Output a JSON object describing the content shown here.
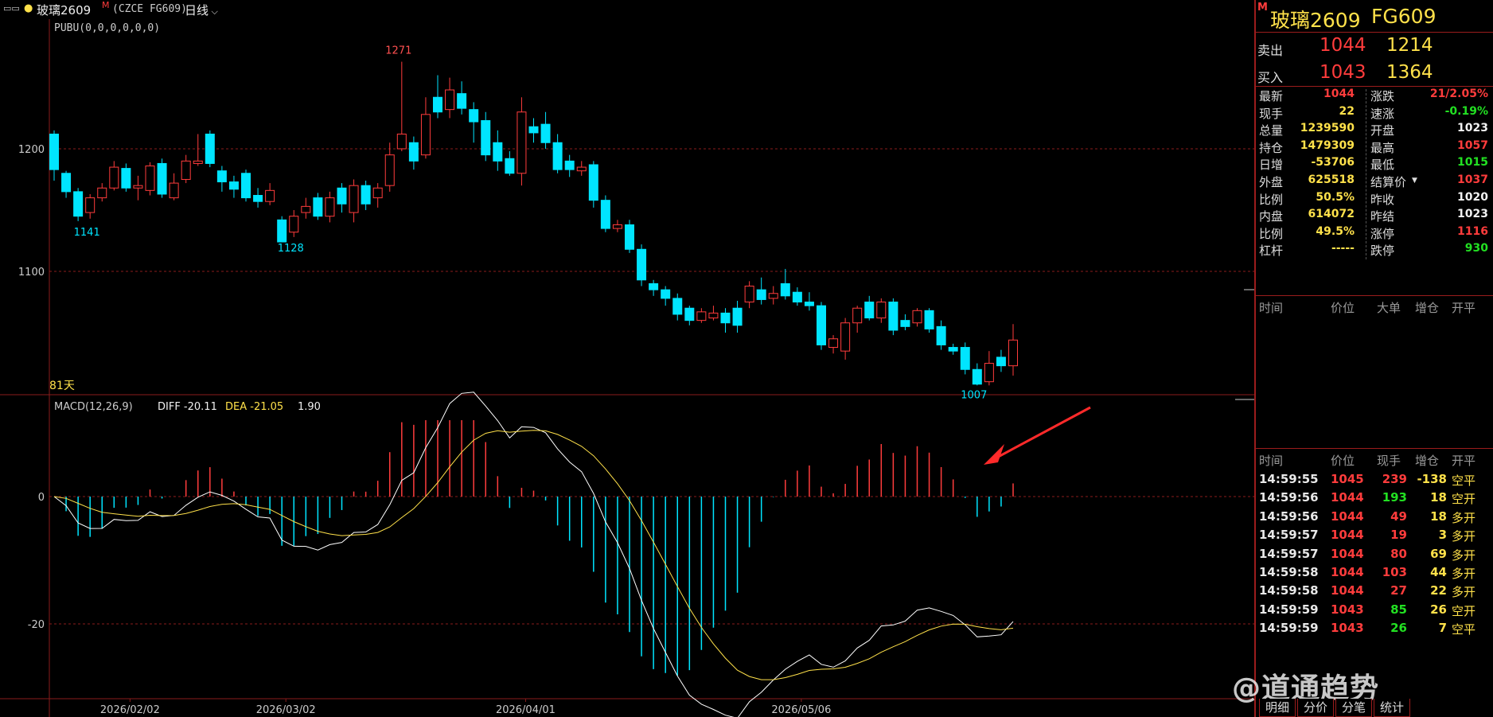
{
  "topbar": {
    "menu_icon": "window-menu-icon",
    "symbol_name": "玻璃2609",
    "symbol_mark": "M",
    "exchange_code": "(CZCE FG609)",
    "period": "日线"
  },
  "chart": {
    "indicator_top": "PUBU(0,0,0,0,0,0)",
    "days_label": "81天",
    "y_ticks_top": [
      "1200",
      "1100"
    ],
    "annotations": {
      "high": "1271",
      "low1": "1141",
      "low2": "1128",
      "low3": "1007"
    },
    "macd_label": "MACD(12,26,9)",
    "diff_label": "DIFF -20.11",
    "dea_label": "DEA -21.05",
    "macd_value": "1.90",
    "y_ticks_bottom": [
      "0",
      "-20"
    ],
    "x_ticks": [
      "2026/02/02",
      "2026/03/02",
      "2026/04/01",
      "2026/05/06"
    ]
  },
  "chart_data": {
    "type": "candlestick",
    "ylim": [
      1002,
      1285
    ],
    "candles": [
      [
        1212,
        1183,
        1215,
        1174
      ],
      [
        1180,
        1165,
        1182,
        1160
      ],
      [
        1165,
        1145,
        1168,
        1141
      ],
      [
        1148,
        1160,
        1163,
        1143
      ],
      [
        1160,
        1168,
        1172,
        1157
      ],
      [
        1168,
        1185,
        1190,
        1166
      ],
      [
        1184,
        1168,
        1188,
        1165
      ],
      [
        1168,
        1170,
        1178,
        1158
      ],
      [
        1166,
        1186,
        1189,
        1162
      ],
      [
        1188,
        1163,
        1192,
        1160
      ],
      [
        1160,
        1172,
        1180,
        1158
      ],
      [
        1175,
        1190,
        1195,
        1172
      ],
      [
        1188,
        1190,
        1212,
        1186
      ],
      [
        1212,
        1188,
        1215,
        1185
      ],
      [
        1182,
        1173,
        1186,
        1165
      ],
      [
        1173,
        1167,
        1178,
        1160
      ],
      [
        1180,
        1160,
        1183,
        1157
      ],
      [
        1162,
        1157,
        1168,
        1152
      ],
      [
        1157,
        1166,
        1172,
        1154
      ],
      [
        1142,
        1124,
        1145,
        1128
      ],
      [
        1132,
        1145,
        1150,
        1128
      ],
      [
        1148,
        1153,
        1160,
        1143
      ],
      [
        1160,
        1145,
        1164,
        1142
      ],
      [
        1145,
        1160,
        1165,
        1140
      ],
      [
        1168,
        1155,
        1172,
        1148
      ],
      [
        1148,
        1170,
        1175,
        1140
      ],
      [
        1170,
        1155,
        1174,
        1150
      ],
      [
        1160,
        1168,
        1172,
        1152
      ],
      [
        1170,
        1195,
        1205,
        1165
      ],
      [
        1200,
        1212,
        1271,
        1198
      ],
      [
        1205,
        1190,
        1210,
        1183
      ],
      [
        1195,
        1228,
        1242,
        1192
      ],
      [
        1242,
        1230,
        1260,
        1225
      ],
      [
        1232,
        1248,
        1258,
        1225
      ],
      [
        1245,
        1233,
        1255,
        1228
      ],
      [
        1232,
        1222,
        1238,
        1205
      ],
      [
        1223,
        1195,
        1230,
        1190
      ],
      [
        1205,
        1190,
        1215,
        1182
      ],
      [
        1192,
        1180,
        1198,
        1178
      ],
      [
        1180,
        1230,
        1242,
        1170
      ],
      [
        1218,
        1213,
        1225,
        1205
      ],
      [
        1220,
        1205,
        1230,
        1200
      ],
      [
        1205,
        1183,
        1212,
        1180
      ],
      [
        1190,
        1183,
        1195,
        1177
      ],
      [
        1182,
        1185,
        1190,
        1178
      ],
      [
        1187,
        1158,
        1190,
        1152
      ],
      [
        1158,
        1135,
        1162,
        1132
      ],
      [
        1135,
        1138,
        1142,
        1132
      ],
      [
        1138,
        1118,
        1142,
        1115
      ],
      [
        1118,
        1093,
        1122,
        1088
      ],
      [
        1090,
        1085,
        1093,
        1080
      ],
      [
        1085,
        1078,
        1088,
        1072
      ],
      [
        1078,
        1065,
        1082,
        1060
      ],
      [
        1070,
        1060,
        1072,
        1056
      ],
      [
        1060,
        1067,
        1070,
        1058
      ],
      [
        1062,
        1066,
        1072,
        1060
      ],
      [
        1066,
        1058,
        1070,
        1050
      ],
      [
        1070,
        1056,
        1076,
        1050
      ],
      [
        1075,
        1088,
        1092,
        1070
      ],
      [
        1085,
        1077,
        1095,
        1073
      ],
      [
        1078,
        1082,
        1088,
        1073
      ],
      [
        1090,
        1080,
        1102,
        1077
      ],
      [
        1083,
        1075,
        1087,
        1072
      ],
      [
        1075,
        1072,
        1083,
        1068
      ],
      [
        1072,
        1040,
        1075,
        1036
      ],
      [
        1038,
        1045,
        1048,
        1033
      ],
      [
        1035,
        1058,
        1062,
        1028
      ],
      [
        1058,
        1070,
        1072,
        1050
      ],
      [
        1075,
        1062,
        1080,
        1060
      ],
      [
        1062,
        1075,
        1078,
        1058
      ],
      [
        1075,
        1052,
        1078,
        1048
      ],
      [
        1060,
        1055,
        1065,
        1052
      ],
      [
        1058,
        1068,
        1070,
        1055
      ],
      [
        1068,
        1053,
        1070,
        1050
      ],
      [
        1055,
        1040,
        1060,
        1036
      ],
      [
        1038,
        1035,
        1041,
        1032
      ],
      [
        1038,
        1020,
        1042,
        1016
      ],
      [
        1020,
        1008,
        1025,
        1007
      ],
      [
        1010,
        1025,
        1035,
        1007
      ],
      [
        1030,
        1023,
        1036,
        1018
      ],
      [
        1023,
        1044,
        1057,
        1015
      ]
    ],
    "macd_range": [
      -30,
      12
    ]
  },
  "quote": {
    "title_mark": "M",
    "title": "玻璃2609",
    "code": "FG609",
    "sell_label": "卖出",
    "sell_price": "1044",
    "sell_vol": "1214",
    "buy_label": "买入",
    "buy_price": "1043",
    "buy_vol": "1364",
    "fields_left": [
      {
        "label": "最新",
        "value": "1044",
        "color": "red"
      },
      {
        "label": "现手",
        "value": "22",
        "color": "yellow"
      },
      {
        "label": "总量",
        "value": "1239590",
        "color": "yellow"
      },
      {
        "label": "持仓",
        "value": "1479309",
        "color": "yellow"
      },
      {
        "label": "日增",
        "value": "-53706",
        "color": "yellow"
      },
      {
        "label": "外盘",
        "value": "625518",
        "color": "yellow"
      },
      {
        "label": "比例",
        "value": "50.5%",
        "color": "yellow"
      },
      {
        "label": "内盘",
        "value": "614072",
        "color": "yellow"
      },
      {
        "label": "比例",
        "value": "49.5%",
        "color": "yellow"
      },
      {
        "label": "杠杆",
        "value": "-----",
        "color": "yellow"
      }
    ],
    "fields_right": [
      {
        "label": "涨跌",
        "value": "21/2.05%",
        "color": "red"
      },
      {
        "label": "速涨",
        "value": "-0.19%",
        "color": "green"
      },
      {
        "label": "开盘",
        "value": "1023",
        "color": "white"
      },
      {
        "label": "最高",
        "value": "1057",
        "color": "red"
      },
      {
        "label": "最低",
        "value": "1015",
        "color": "green"
      },
      {
        "label": "结算价",
        "value": "1037",
        "color": "red"
      },
      {
        "label": "昨收",
        "value": "1020",
        "color": "white"
      },
      {
        "label": "昨结",
        "value": "1023",
        "color": "white"
      },
      {
        "label": "涨停",
        "value": "1116",
        "color": "red"
      },
      {
        "label": "跌停",
        "value": "930",
        "color": "green"
      }
    ],
    "big_header": [
      "时间",
      "价位",
      "大单",
      "增仓",
      "开平"
    ],
    "tick_header": [
      "时间",
      "价位",
      "现手",
      "增仓",
      "开平"
    ],
    "ticks": [
      {
        "time": "14:59:55",
        "price": "1045",
        "vol": "239",
        "chg": "-138",
        "type": "空平",
        "price_color": "red",
        "vol_color": "red",
        "chg_color": "yellow"
      },
      {
        "time": "14:59:56",
        "price": "1044",
        "vol": "193",
        "chg": "18",
        "type": "空开",
        "price_color": "red",
        "vol_color": "green",
        "chg_color": "yellow"
      },
      {
        "time": "14:59:56",
        "price": "1044",
        "vol": "49",
        "chg": "18",
        "type": "多开",
        "price_color": "red",
        "vol_color": "red",
        "chg_color": "yellow"
      },
      {
        "time": "14:59:57",
        "price": "1044",
        "vol": "19",
        "chg": "3",
        "type": "多开",
        "price_color": "red",
        "vol_color": "red",
        "chg_color": "yellow"
      },
      {
        "time": "14:59:57",
        "price": "1044",
        "vol": "80",
        "chg": "69",
        "type": "多开",
        "price_color": "red",
        "vol_color": "red",
        "chg_color": "yellow"
      },
      {
        "time": "14:59:58",
        "price": "1044",
        "vol": "103",
        "chg": "44",
        "type": "多开",
        "price_color": "red",
        "vol_color": "red",
        "chg_color": "yellow"
      },
      {
        "time": "14:59:58",
        "price": "1044",
        "vol": "27",
        "chg": "22",
        "type": "多开",
        "price_color": "red",
        "vol_color": "red",
        "chg_color": "yellow"
      },
      {
        "time": "14:59:59",
        "price": "1043",
        "vol": "85",
        "chg": "26",
        "type": "空开",
        "price_color": "red",
        "vol_color": "green",
        "chg_color": "yellow"
      },
      {
        "time": "14:59:59",
        "price": "1043",
        "vol": "26",
        "chg": "7",
        "type": "空平",
        "price_color": "red",
        "vol_color": "green",
        "chg_color": "yellow"
      }
    ],
    "tabs": [
      "明细",
      "分价",
      "分笔",
      "统计"
    ]
  },
  "watermark": "@道通趋势",
  "colors": {
    "up": "#ff3c3c",
    "down": "#00e5ff",
    "grid": "#8a1c1c",
    "arrow": "#ff2a2a",
    "diff": "#ffffff",
    "dea": "#ffe14a"
  }
}
